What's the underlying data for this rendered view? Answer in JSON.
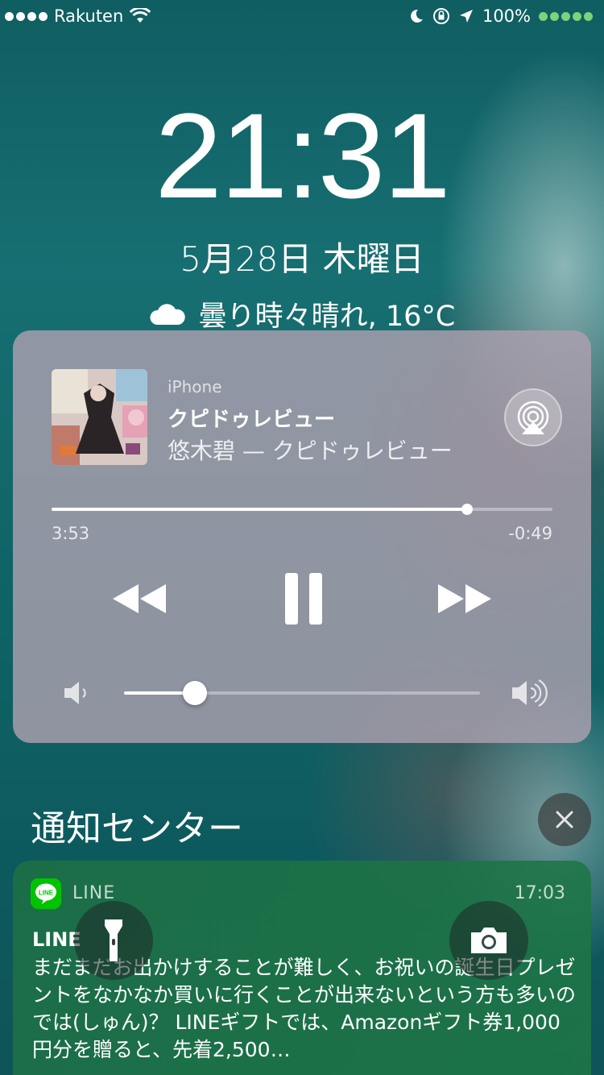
{
  "status_bar": {
    "carrier": "Rakuten",
    "battery": "100%",
    "icons": [
      "signal-dots-icon",
      "wifi-icon",
      "moon-icon",
      "rotation-lock-icon",
      "location-icon",
      "battery-dots-icon"
    ]
  },
  "lock_screen": {
    "time": "21:31",
    "date": "5月28日 木曜日",
    "weather": "曇り時々晴れ, 16°C",
    "weather_icon": "cloud-icon"
  },
  "now_playing": {
    "source": "iPhone",
    "title": "クピドゥレビュー",
    "subtitle": "悠木碧 — クピドゥレビュー",
    "elapsed": "3:53",
    "remaining": "-0:49",
    "progress_fraction": 0.83,
    "volume_fraction": 0.2,
    "controls": [
      "rewind-icon",
      "pause-icon",
      "fast-forward-icon"
    ]
  },
  "notification_center": {
    "title": "通知センター"
  },
  "notification": {
    "app": "LINE",
    "time": "17:03",
    "sender": "LINE",
    "body": "まだまだお出かけすることが難しく、お祝いの誕生日プレゼントをなかなか買いに行くことが出来ないという方も多いのでは(しゅん)？ LINEギフトでは、Amazonギフト券1,000円分を贈ると、先着2,500…"
  },
  "colors": {
    "battery_green": "#7cd37a",
    "line_green": "#00c300"
  }
}
